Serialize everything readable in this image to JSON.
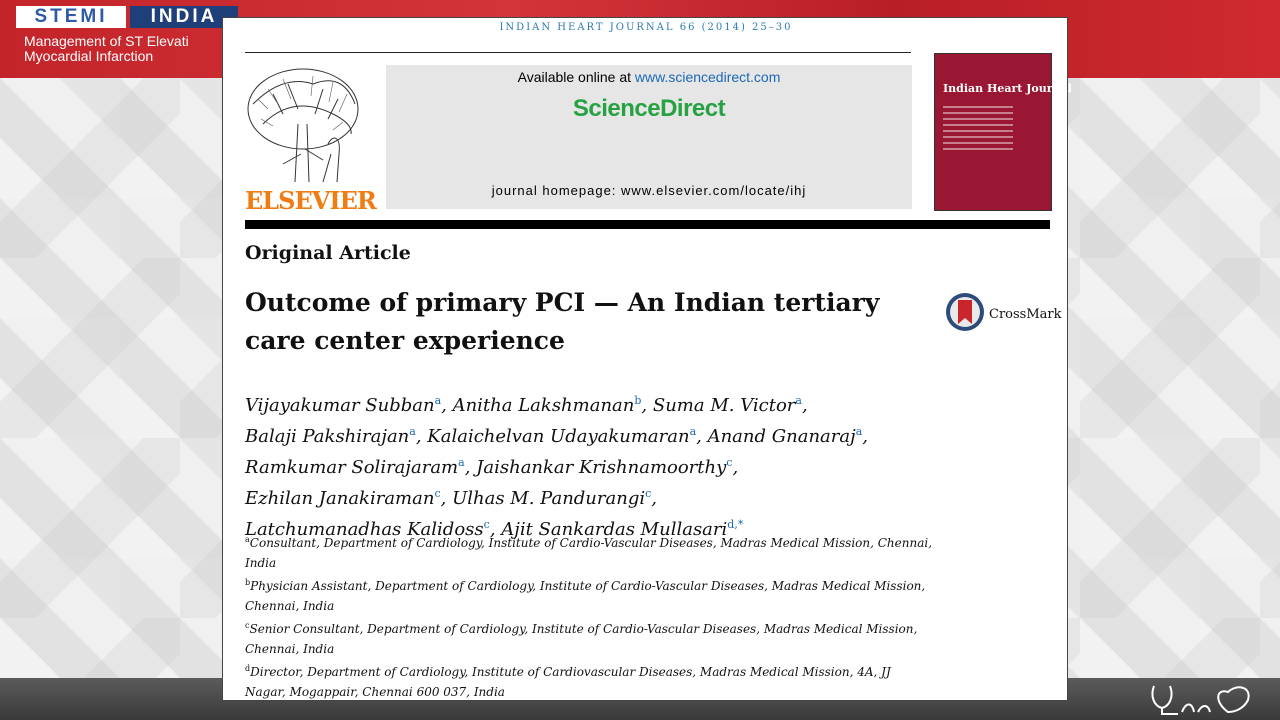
{
  "slide": {
    "brand_stemi": "STEMI",
    "brand_india": "INDIA",
    "brand_subtitle_line1": "Management of ST Elevati",
    "brand_subtitle_line2": "Myocardial Infarction"
  },
  "paper": {
    "journal_header": "INDIAN HEART JOURNAL 66 (2014) 25–30",
    "publisher": "ELSEVIER",
    "available_prefix": "Available online at ",
    "available_url": "www.sciencedirect.com",
    "sciencedirect": "ScienceDirect",
    "journal_homepage": "journal homepage: www.elsevier.com/locate/ihj",
    "cover_title": "Indian Heart Journal",
    "article_type": "Original Article",
    "title": "Outcome of primary PCI — An Indian tertiary care center experience",
    "crossmark": "CrossMark",
    "authors": [
      {
        "name": "Vijayakumar Subban",
        "sup": "a",
        "sep": ", "
      },
      {
        "name": "Anitha Lakshmanan",
        "sup": "b",
        "sep": ", "
      },
      {
        "name": "Suma M. Victor",
        "sup": "a",
        "sep": ","
      },
      {
        "name": "Balaji Pakshirajan",
        "sup": "a",
        "sep": ", "
      },
      {
        "name": "Kalaichelvan Udayakumaran",
        "sup": "a",
        "sep": ", "
      },
      {
        "name": "Anand Gnanaraj",
        "sup": "a",
        "sep": ","
      },
      {
        "name": "Ramkumar Solirajaram",
        "sup": "a",
        "sep": ", "
      },
      {
        "name": "Jaishankar Krishnamoorthy",
        "sup": "c",
        "sep": ","
      },
      {
        "name": "Ezhilan Janakiraman",
        "sup": "c",
        "sep": ", "
      },
      {
        "name": "Ulhas M. Pandurangi",
        "sup": "c",
        "sep": ","
      },
      {
        "name": "Latchumanadhas Kalidoss",
        "sup": "c",
        "sep": ", "
      },
      {
        "name": "Ajit Sankardas Mullasari",
        "sup": "d,*",
        "sep": ""
      }
    ],
    "affiliations": [
      {
        "key": "a",
        "text": "Consultant, Department of Cardiology, Institute of Cardio-Vascular Diseases, Madras Medical Mission, Chennai, India"
      },
      {
        "key": "b",
        "text": "Physician Assistant, Department of Cardiology, Institute of Cardio-Vascular Diseases, Madras Medical Mission, Chennai, India"
      },
      {
        "key": "c",
        "text": "Senior Consultant, Department of Cardiology, Institute of Cardio-Vascular Diseases, Madras Medical Mission, Chennai, India"
      },
      {
        "key": "d",
        "text": "Director, Department of Cardiology, Institute of Cardiovascular Diseases, Madras Medical Mission, 4A, JJ Nagar, Mogappair, Chennai 600 037, India"
      }
    ]
  },
  "colors": {
    "accent_red": "#c3242a",
    "link_blue": "#1a69b5",
    "sciencedirect_green": "#27a243",
    "elsevier_orange": "#f07d14"
  }
}
